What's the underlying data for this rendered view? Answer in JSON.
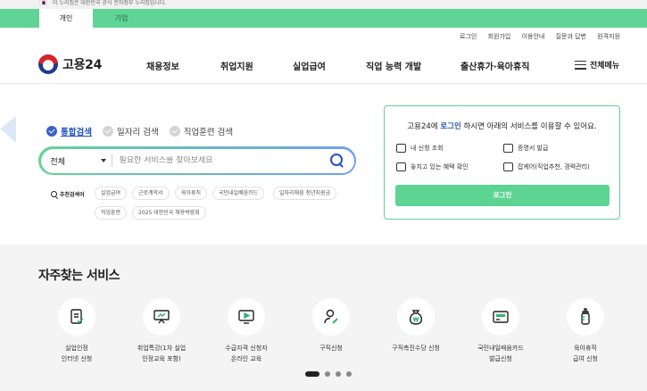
{
  "gov_banner": {
    "text": "이 누리집은 대한민국 공식 전자정부 누리집입니다."
  },
  "tabs": [
    {
      "label": "개인",
      "active": true
    },
    {
      "label": "기업",
      "active": false
    }
  ],
  "util_links": [
    "로그인",
    "회원가입",
    "이용안내",
    "질문과 답변",
    "원격지원"
  ],
  "brand": {
    "name": "고용24"
  },
  "gnb": [
    "채용정보",
    "취업지원",
    "실업급여",
    "직업 능력 개발",
    "출산휴가·육아휴직"
  ],
  "allmenu": {
    "label": "전체메뉴"
  },
  "search": {
    "tabs": [
      {
        "label": "통합검색",
        "active": true
      },
      {
        "label": "일자리 검색",
        "active": false
      },
      {
        "label": "직업훈련 검색",
        "active": false
      }
    ],
    "category": "전체",
    "placeholder": "필요한 서비스를 찾아보세요",
    "recommended_label": "추천검색어",
    "keywords": [
      "실업급여",
      "근로계약서",
      "육아휴직",
      "국민내일배움카드",
      "일자리채움 청년지원금",
      "직업훈련",
      "2025 대한민국 채용박람회"
    ]
  },
  "login_card": {
    "prefix": "고용24에 ",
    "login_word": "로그인",
    "suffix": " 하시면 아래의 서비스를 이용할 수 있어요.",
    "items": [
      "내 신청 조회",
      "증명서 발급",
      "놓치고 있는 혜택 확인",
      "잡케어(직업추천, 경력관리)"
    ],
    "button": "로그인"
  },
  "services": {
    "title": "자주찾는 서비스",
    "items": [
      {
        "line1": "실업인정",
        "line2": "인터넷 신청",
        "icon": "document-check-icon"
      },
      {
        "line1": "취업특강(1차 실업",
        "line2": "인정교육 포함)",
        "icon": "lecture-board-icon"
      },
      {
        "line1": "수급자격 신청자",
        "line2": "온라인 교육",
        "icon": "monitor-play-icon"
      },
      {
        "line1": "구직신청",
        "line2": "",
        "icon": "person-edit-icon"
      },
      {
        "line1": "구직촉진수당 신청",
        "line2": "",
        "icon": "money-bag-icon"
      },
      {
        "line1": "국민내일배움카드",
        "line2": "발급신청",
        "icon": "card-icon"
      },
      {
        "line1": "육아휴직",
        "line2": "급여 신청",
        "icon": "baby-bottle-icon"
      }
    ],
    "pagination": {
      "current": 1,
      "total": 4
    }
  },
  "colors": {
    "brand_green": "#5fd495",
    "brand_blue": "#2451c0"
  }
}
